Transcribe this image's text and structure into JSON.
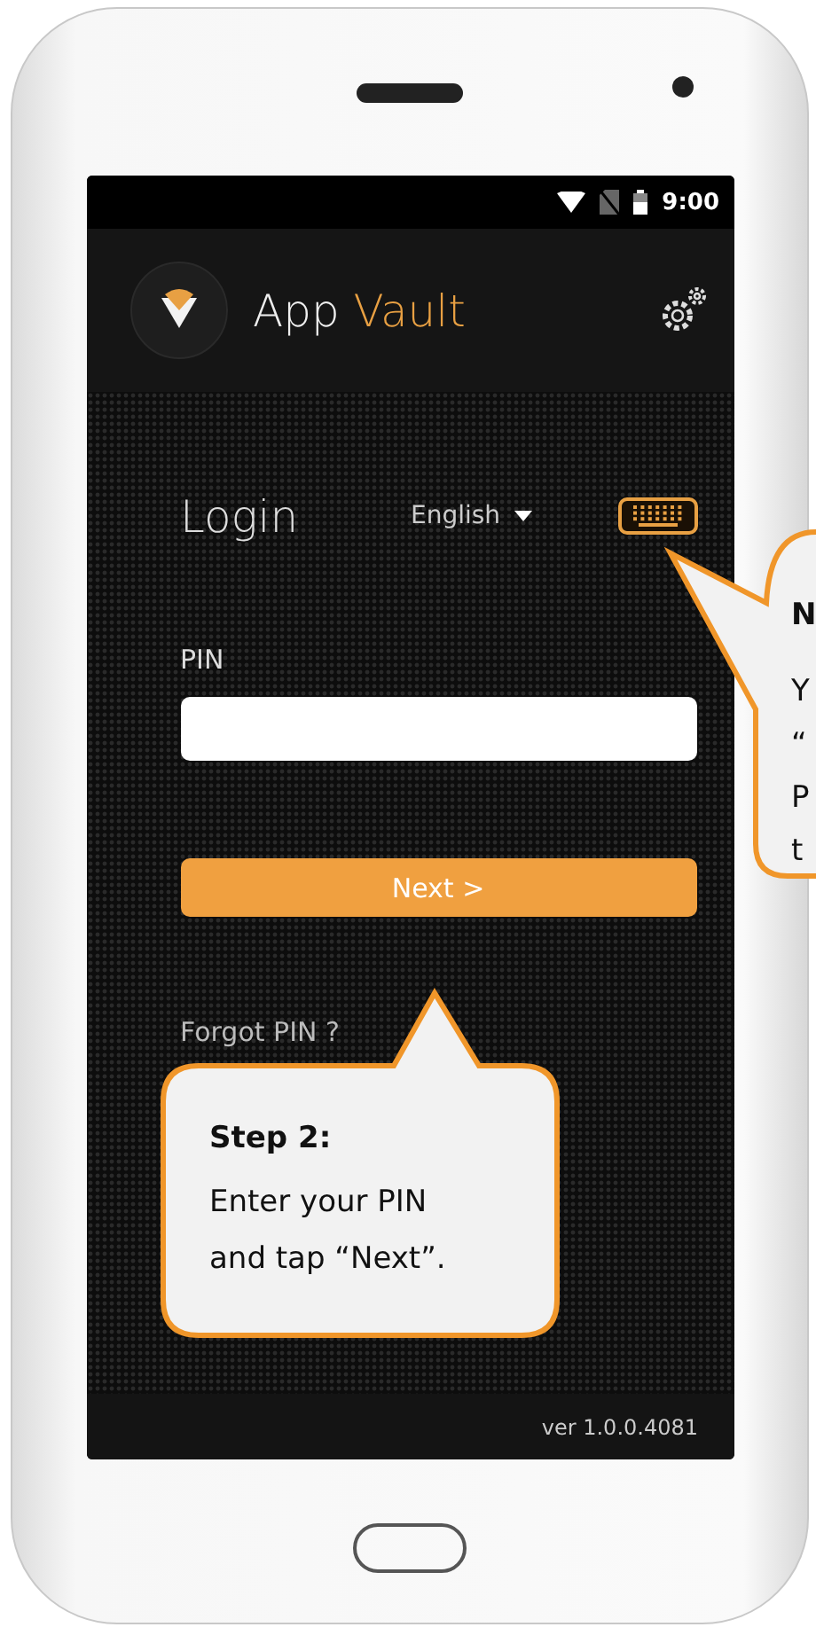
{
  "status_bar": {
    "time": "9:00"
  },
  "header": {
    "app_name": [
      "App",
      "Vault"
    ]
  },
  "login": {
    "title": "Login",
    "language": "English",
    "pin_label": "PIN",
    "next_button": "Next >",
    "forgot_link": "Forgot PIN ?"
  },
  "footer": {
    "version": "ver 1.0.0.4081"
  },
  "callouts": [
    {
      "kind": "bottom",
      "title": "Step 2:",
      "lines": [
        "Enter your PIN",
        "and tap “Next”."
      ]
    },
    {
      "kind": "side",
      "title": "N",
      "lines": [
        "Y",
        "“",
        "P",
        "t"
      ]
    }
  ]
}
